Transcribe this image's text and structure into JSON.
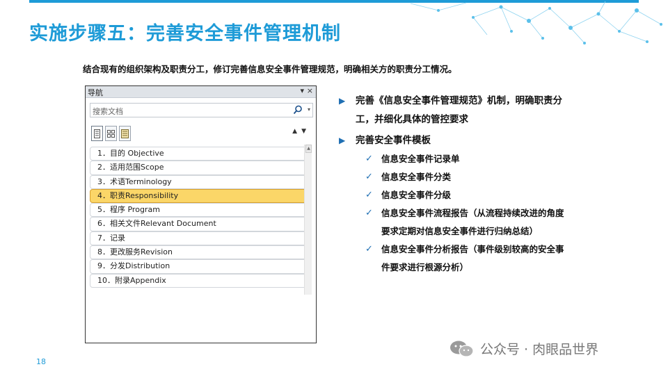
{
  "colors": {
    "accent": "#1e9bd7",
    "selected": "#fbd668",
    "bullet": "#1f6fb3"
  },
  "slide": {
    "title": "实施步骤五：完善安全事件管理机制",
    "intro": "结合现有的组织架构及职责分工，修订完善信息安全事件管理规范，明确相关方的职责分工情况。",
    "page_number": "18"
  },
  "nav": {
    "title": "导航",
    "dropdown_glyph": "▾",
    "close_glyph": "×",
    "search_placeholder": "搜索文档",
    "arrows": "▲▼",
    "selected_index": 3,
    "items": [
      "1．目的 Objective",
      "2．适用范围Scope",
      "3．术语Terminology",
      "4．职责Responsibility",
      "5．程序 Program",
      "6．相关文件Relevant Document",
      "7．记录",
      "8．更改服务Revision",
      "9．分发Distribution",
      "10．附录Appendix"
    ]
  },
  "bullets": {
    "b1": "完善《信息安全事件管理规范》机制，明确职责分工，并细化具体的管控要求",
    "b2": "完善安全事件模板",
    "sub": [
      "信息安全事件记录单",
      "信息安全事件分类",
      "信息安全事件分级",
      "信息安全事件流程报告（从流程持续改进的角度要求定期对信息安全事件进行归纳总结）",
      "信息安全事件分析报告（事件级别较高的安全事件要求进行根源分析）"
    ]
  },
  "watermark": "公众号 · 肉眼品世界"
}
